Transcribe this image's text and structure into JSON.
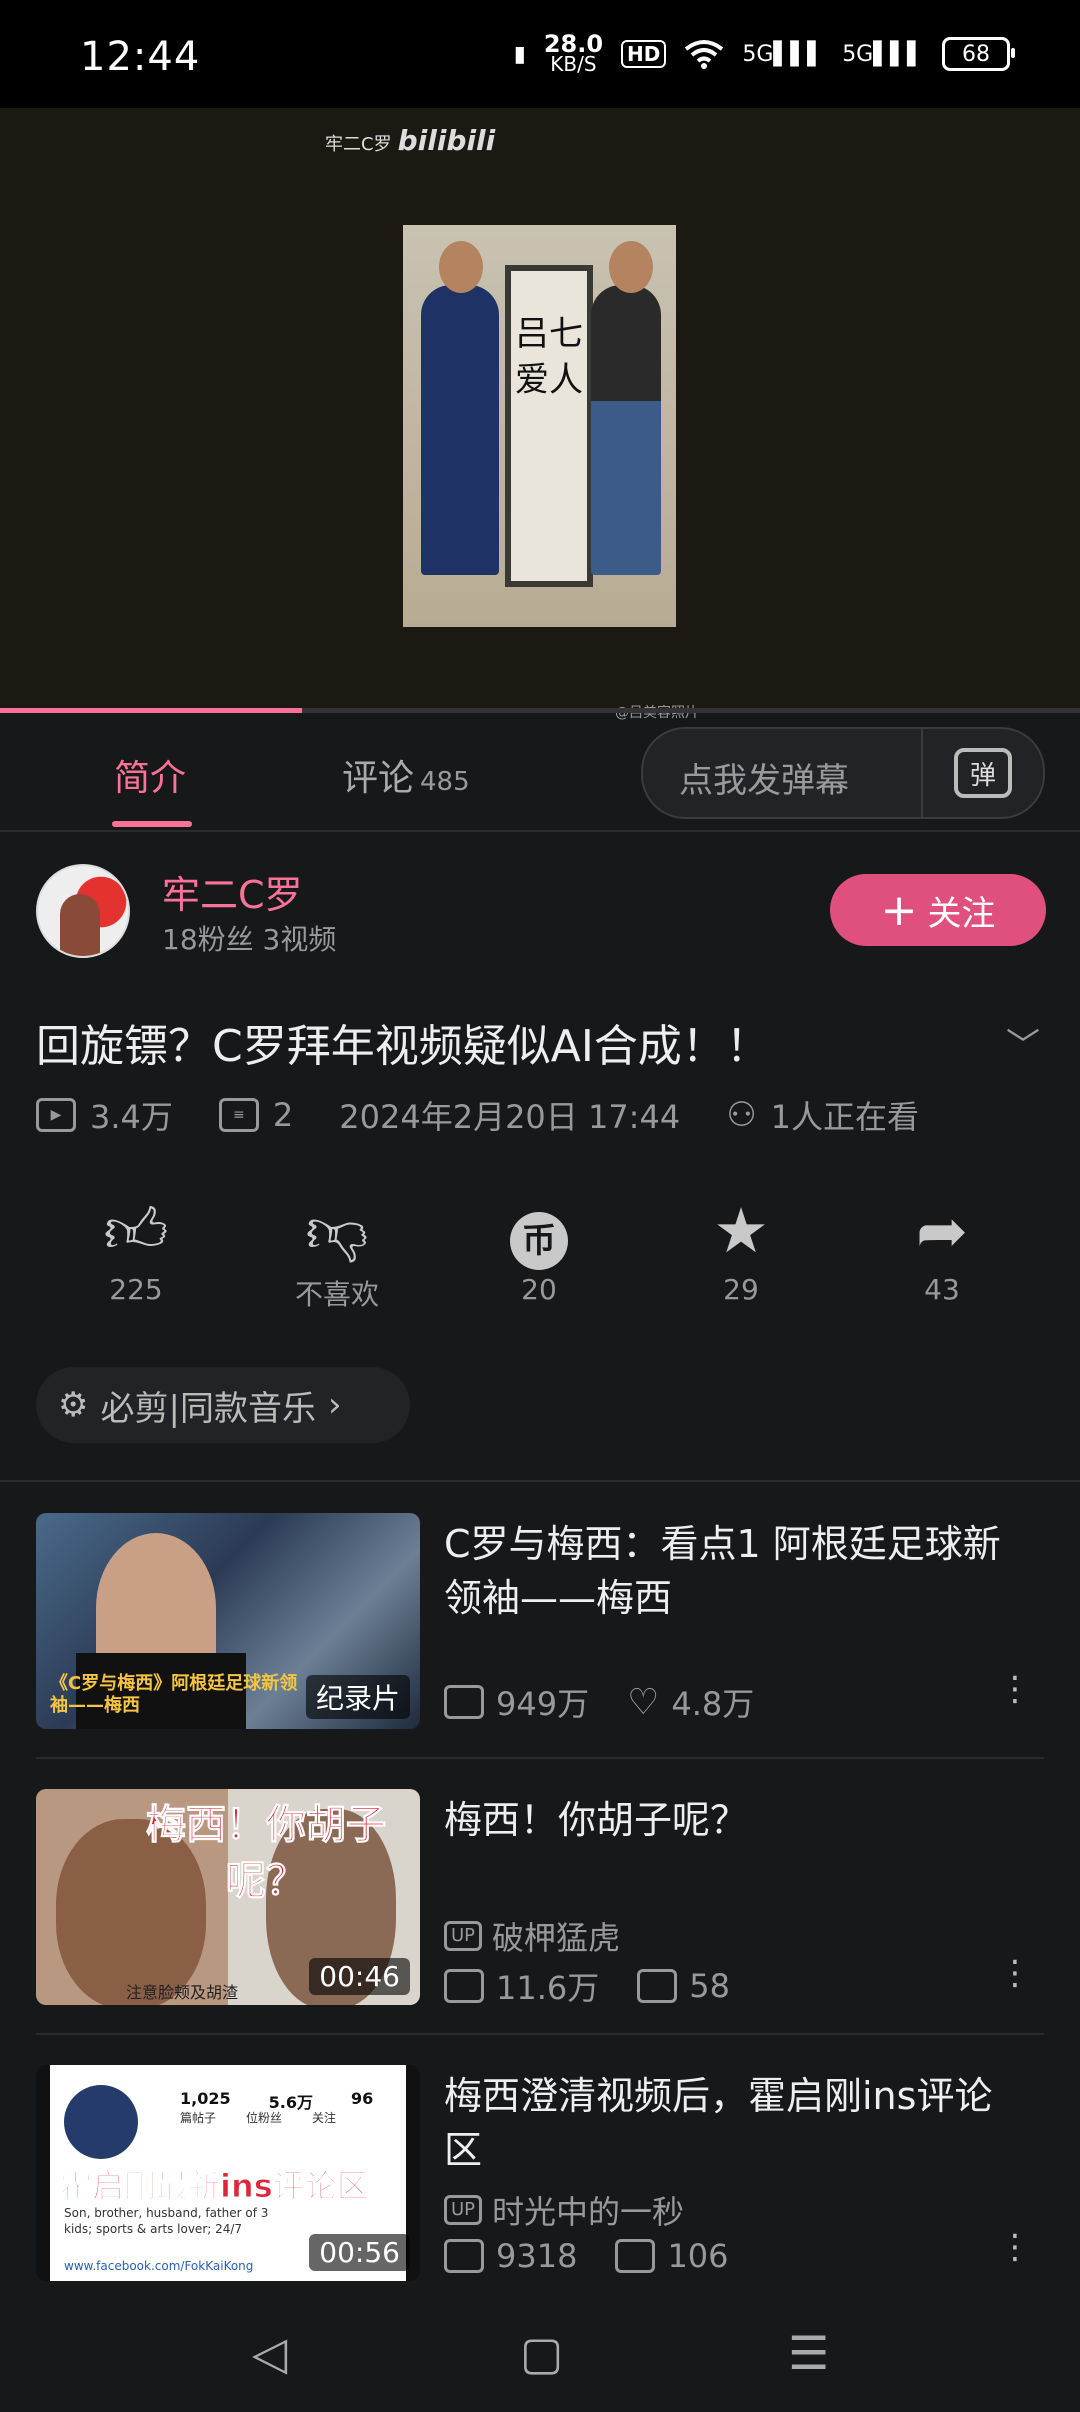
{
  "status_bar": {
    "time": "12:44",
    "net_speed_value": "28.0",
    "net_speed_unit": "KB/S",
    "hd": "HD",
    "signal1": "5G",
    "signal2": "5G",
    "battery": "68"
  },
  "video": {
    "watermark_channel": "牢二C罗",
    "watermark_logo": "bilibili",
    "scroll_text": "吕七爱人",
    "progress_fraction": 0.28,
    "copyright": "@吕美容照片"
  },
  "tabs": {
    "intro": "简介",
    "comments": "评论",
    "comment_count": "485",
    "danmaku_placeholder": "点我发弹幕",
    "danmaku_button": "弹"
  },
  "uploader": {
    "name": "牢二C罗",
    "stats": "18粉丝   3视频",
    "follow_label": "关注"
  },
  "video_info": {
    "title": "回旋镖？C罗拜年视频疑似AI合成！！",
    "views": "3.4万",
    "danmaku": "2",
    "date": "2024年2月20日 17:44",
    "watching": "1人正在看"
  },
  "actions": {
    "like": "225",
    "dislike": "不喜欢",
    "coin": "20",
    "favorite": "29",
    "share": "43",
    "coin_glyph": "币"
  },
  "music": {
    "label": "必剪|同款音乐"
  },
  "recommendations": [
    {
      "title": "C罗与梅西：看点1 阿根廷足球新领袖——梅西",
      "tag": "纪录片",
      "views": "949万",
      "likes": "4.8万",
      "thumb_caption": "《C罗与梅西》阿根廷足球新领袖——梅西"
    },
    {
      "title": "梅西！你胡子呢？",
      "tag": "00:46",
      "up": "破柙猛虎",
      "views": "11.6万",
      "danmaku": "58",
      "thumb_caption": "梅西！你胡子呢？",
      "thumb_subtitle": "注意脸颊及胡渣"
    },
    {
      "title": "梅西澄清视频后，霍启刚ins评论区",
      "tag": "00:56",
      "up": "时光中的一秒",
      "views": "9318",
      "danmaku": "106",
      "thumb_caption": "霍启刚最新ins评论区",
      "thumb_stats": [
        "1,025",
        "5.6万",
        "96"
      ],
      "thumb_stat_labels": [
        "篇帖子",
        "位粉丝",
        "关注"
      ],
      "thumb_bio": "Son, brother, husband, father of 3 kids; sports & arts lover; 24/7",
      "thumb_link": "www.facebook.com/FokKaiKong"
    }
  ],
  "colors": {
    "accent": "#fb7299",
    "follow_bg": "#e0507e",
    "background": "#17181a"
  }
}
